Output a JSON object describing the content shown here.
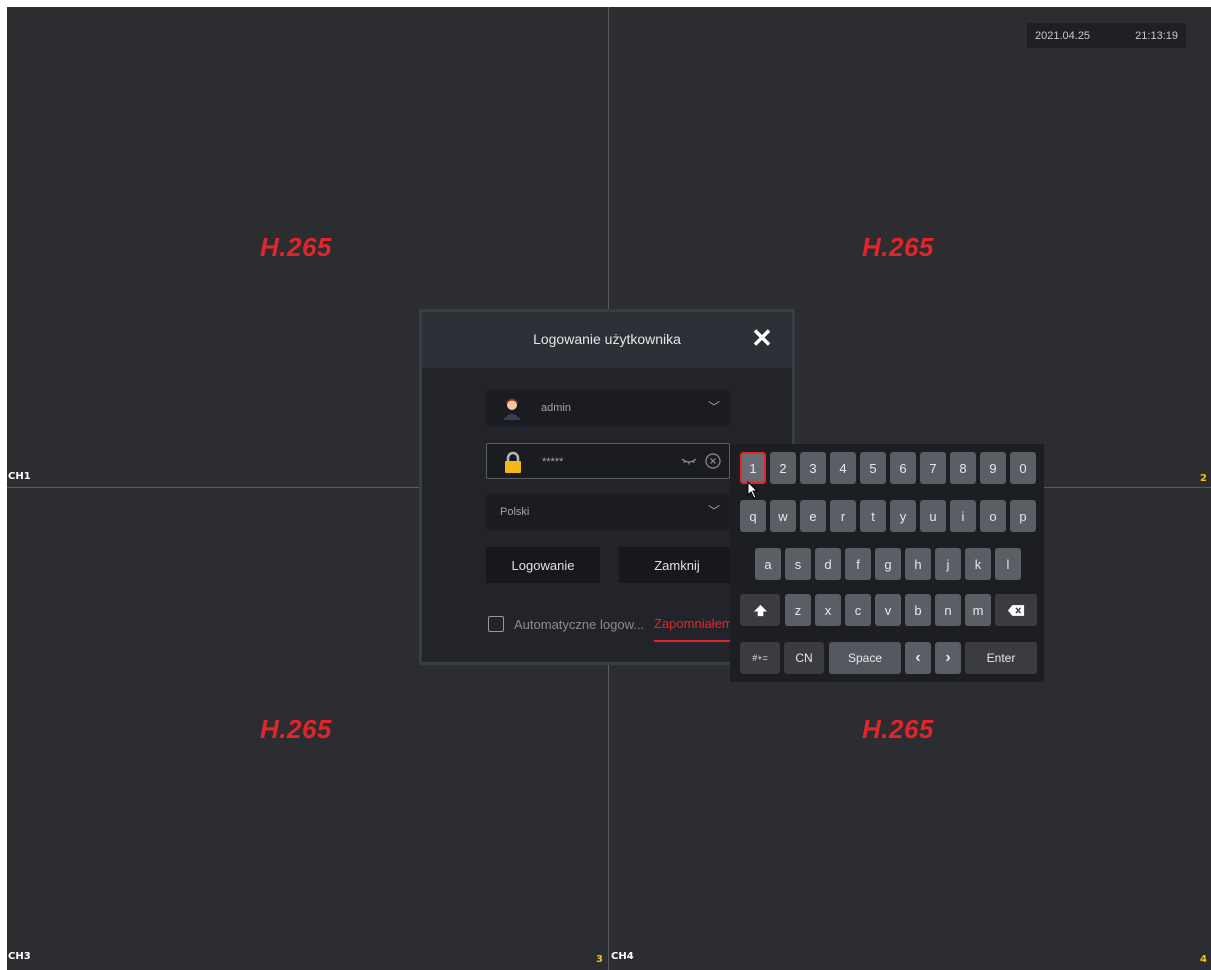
{
  "status": {
    "date": "2021.04.25",
    "time": "21:13:19"
  },
  "channels": [
    {
      "label": "CH1",
      "codec": "H.265"
    },
    {
      "label": "2",
      "codec": "H.265"
    },
    {
      "label": "CH3",
      "codec": "H.265",
      "num": "3"
    },
    {
      "label": "CH4",
      "codec": "H.265",
      "num": "4"
    }
  ],
  "dialog": {
    "title": "Logowanie użytkownika",
    "username": "admin",
    "password": "*****",
    "language": "Polski",
    "login_label": "Logowanie",
    "close_label": "Zamknij",
    "auto_login_label": "Automatyczne logow...",
    "forgot_label": "Zapomniałem"
  },
  "keyboard": {
    "row1": [
      "1",
      "2",
      "3",
      "4",
      "5",
      "6",
      "7",
      "8",
      "9",
      "0"
    ],
    "row2": [
      "q",
      "w",
      "e",
      "r",
      "t",
      "y",
      "u",
      "i",
      "o",
      "p"
    ],
    "row3": [
      "a",
      "s",
      "d",
      "f",
      "g",
      "h",
      "j",
      "k",
      "l"
    ],
    "row4": [
      "z",
      "x",
      "c",
      "v",
      "b",
      "n",
      "m"
    ],
    "sym_label": "#+=",
    "cn_label": "CN",
    "space_label": "Space",
    "enter_label": "Enter",
    "active_key": "1"
  },
  "colors": {
    "accent": "#e0262a",
    "channel_num": "#f1c40f",
    "background": "#2c2d31"
  }
}
